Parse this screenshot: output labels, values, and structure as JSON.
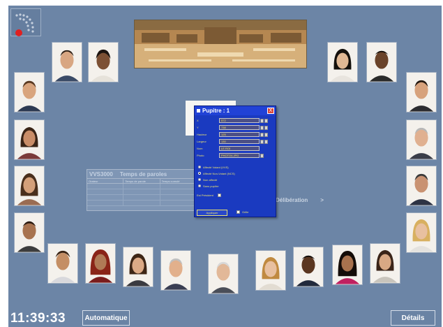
{
  "clock": "11:39:33",
  "buttons": {
    "automatique": "Automatique",
    "details": "Détails"
  },
  "vvs_panel": {
    "title_left": "VVS3000",
    "title_right": "Temps de paroles",
    "columns": [
      "Orateur",
      "Temps de parole",
      "Temps cumulé"
    ]
  },
  "deliberation": {
    "label": "Délibération",
    "arrow": ">"
  },
  "pupitre": {
    "title": "Pupitre : 1",
    "close": "X",
    "fields": [
      {
        "label": "X",
        "value": "572"
      },
      {
        "label": "Y",
        "value": "738"
      },
      {
        "label": "Hauteur",
        "value": "125"
      },
      {
        "label": "Largeur",
        "value": "130"
      },
      {
        "label": "Nom",
        "value": "LE ROI"
      },
      {
        "label": "Photo",
        "value": "PHOTO4.JPG"
      }
    ],
    "radios": [
      {
        "label": "Affecté Votant (VVS)",
        "selected": false
      },
      {
        "label": "Affecté Non-Votant (NCS)",
        "selected": true
      },
      {
        "label": "Non affecté",
        "selected": false
      },
      {
        "label": "Sans pupitre",
        "selected": false
      }
    ],
    "president_label": "Est Président",
    "apply": "Appliquer",
    "grille": "Grille"
  },
  "colors": {
    "stage": "#6c85a6",
    "dialog": "#1a3ac0",
    "dialog_text": "#e8e070",
    "active_dot": "#e02020"
  },
  "icons": {
    "logo": "semicircle-seating-icon",
    "banner": "versailles-palace-image"
  }
}
